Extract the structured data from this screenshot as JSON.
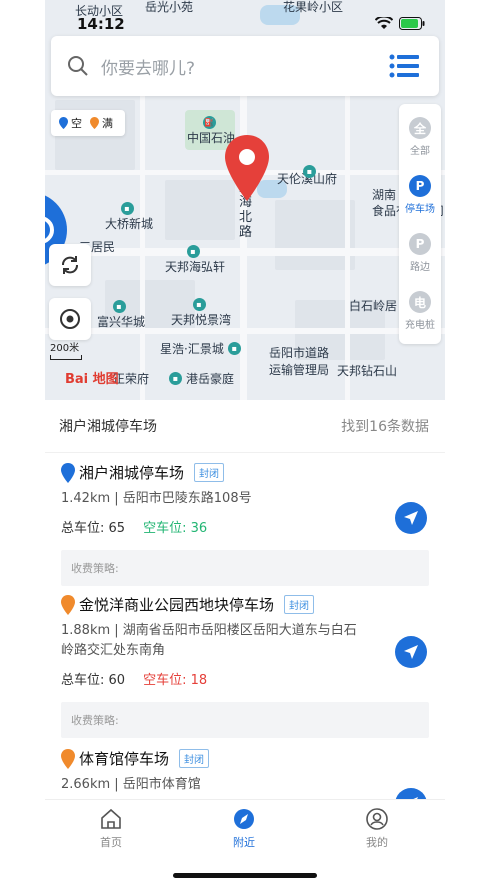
{
  "status": {
    "time": "14:12",
    "map_top_labels": [
      "长动小区",
      "岳光小苑",
      "花果岭小区"
    ]
  },
  "search": {
    "placeholder": "你要去哪儿?"
  },
  "legend": {
    "empty_label": "空",
    "full_label": "满"
  },
  "right_tools": [
    {
      "label": "全部",
      "icon_text": "全"
    },
    {
      "label": "停车场",
      "icon_text": "P"
    },
    {
      "label": "路边",
      "icon_text": "P"
    },
    {
      "label": "充电桩",
      "icon_text": "电"
    }
  ],
  "map": {
    "scale_label": "200米",
    "logo_text": "Bai 地图",
    "pois": {
      "zhongguo_shihua": "中国石油",
      "tianlun": "天伦溪山府",
      "hunan_food": "湖南\n食品有限公司",
      "daqiao": "大桥新城",
      "tianbang_haihong": "天邦海弘轩",
      "yang_juming": "三居民",
      "fuxing": "富兴华城",
      "tianbang_yuejing": "天邦悦景湾",
      "xinghao": "星浩·汇景城",
      "yueyang_road": "岳阳市道路\n运输管理局",
      "tianbang_zuanshi": "天邦钻石山",
      "gangyue": "港岳豪庭",
      "baishiling": "白石岭居",
      "zhengrong": "正荣府"
    },
    "road_label": "通海北路",
    "yue_label": "岳"
  },
  "list": {
    "title": "湘户湘城停车场",
    "count_text": "找到16条数据",
    "items": [
      {
        "name": "湘户湘城停车场",
        "badge": "封闭",
        "pin_color": "#1e6fd9",
        "address": "1.42km | 岳阳市巴陵东路108号",
        "total": "总车位: 65",
        "free": "空车位: 36",
        "free_color": "#22b573",
        "fee": "收费策略:"
      },
      {
        "name": "金悦洋商业公园西地块停车场",
        "badge": "封闭",
        "pin_color": "#f08a2c",
        "address": "1.88km | 湖南省岳阳市岳阳楼区岳阳大道东与白石岭路交汇处东南角",
        "total": "总车位: 60",
        "free": "空车位: 18",
        "free_color": "#e5403a",
        "fee": "收费策略:"
      },
      {
        "name": "体育馆停车场",
        "badge": "封闭",
        "pin_color": "#f08a2c",
        "address": "2.66km | 岳阳市体育馆",
        "total": "",
        "free": "",
        "free_color": "#22b573",
        "fee": ""
      }
    ]
  },
  "tabs": [
    {
      "label": "首页",
      "icon": "home-icon"
    },
    {
      "label": "附近",
      "icon": "compass-icon"
    },
    {
      "label": "我的",
      "icon": "user-icon"
    }
  ],
  "colors": {
    "accent": "#1e6fd9",
    "pin_red": "#e5403a"
  }
}
